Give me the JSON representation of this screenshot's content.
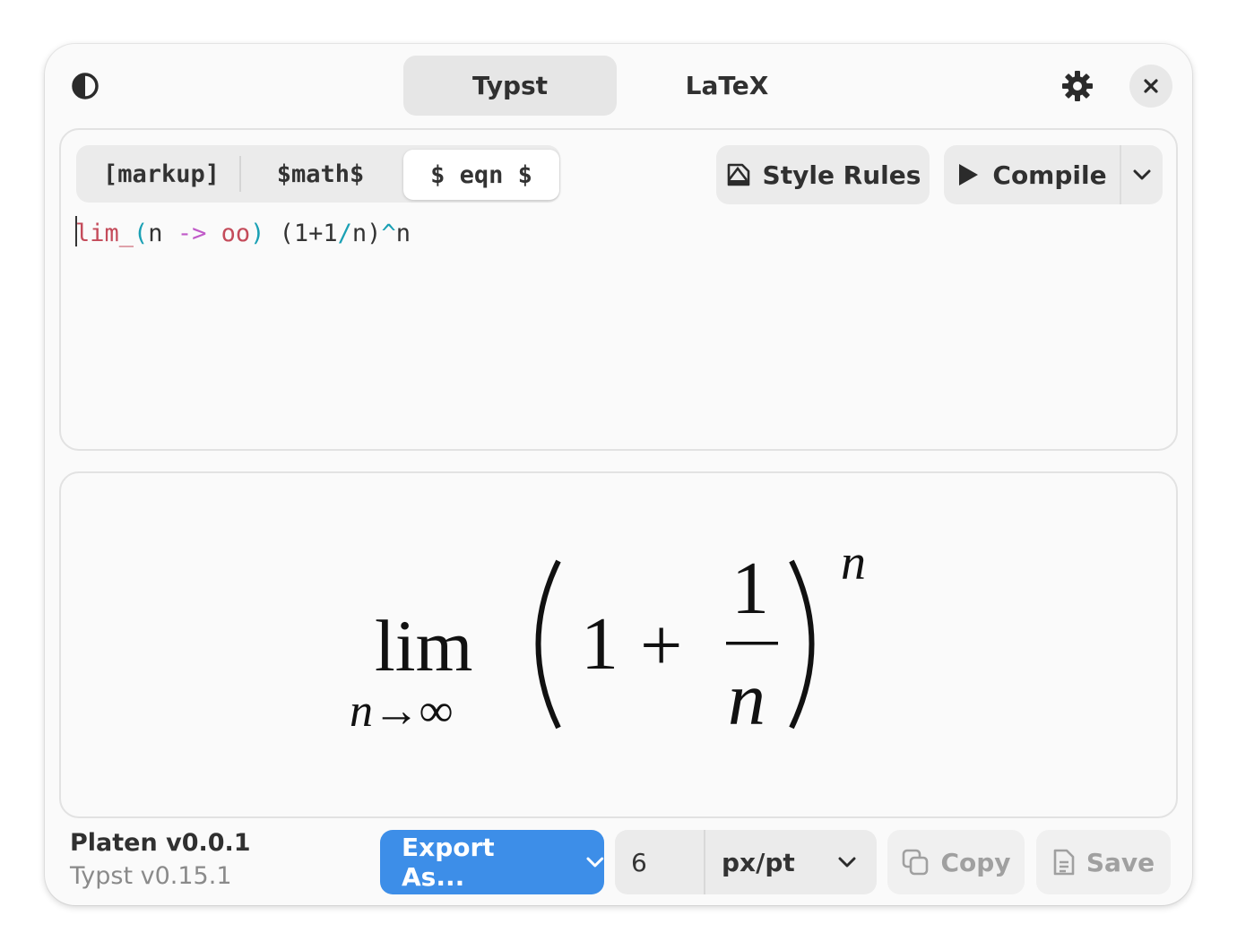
{
  "header": {
    "tabs": [
      {
        "label": "Typst",
        "active": true
      },
      {
        "label": "LaTeX",
        "active": false
      }
    ],
    "icons": [
      "contrast-icon",
      "gear-icon",
      "close-icon"
    ]
  },
  "editor": {
    "modes": [
      {
        "label": "[markup]",
        "active": false
      },
      {
        "label": "$math$",
        "active": false
      },
      {
        "label": "$ eqn $",
        "active": true
      }
    ],
    "style_rules_label": "Style Rules",
    "compile_label": "Compile",
    "code": {
      "t1": "lim_",
      "t2": "(",
      "t3": "n ",
      "t4": "->",
      "t5": " ",
      "t6": "oo",
      "t7": ")",
      "t8": " (1+1",
      "t9": "/",
      "t10": "n)",
      "t11": "^",
      "t12": "n"
    }
  },
  "preview": {
    "formula_lim": "lim",
    "formula_sub": "n→∞",
    "formula_one": "1",
    "formula_plus": "+",
    "formula_num": "1",
    "formula_den": "n",
    "formula_exp": "n"
  },
  "footer": {
    "app_name": "Platen v0.0.1",
    "engine_version": "Typst v0.15.1",
    "export_label": "Export As...",
    "scale_value": "6",
    "unit_label": "px/pt",
    "copy_label": "Copy",
    "save_label": "Save"
  },
  "colors": {
    "accent": "#3d8ee8",
    "code_function": "#c44b5a",
    "code_operator": "#1aa0b4",
    "code_arrow": "#c05ac8"
  }
}
